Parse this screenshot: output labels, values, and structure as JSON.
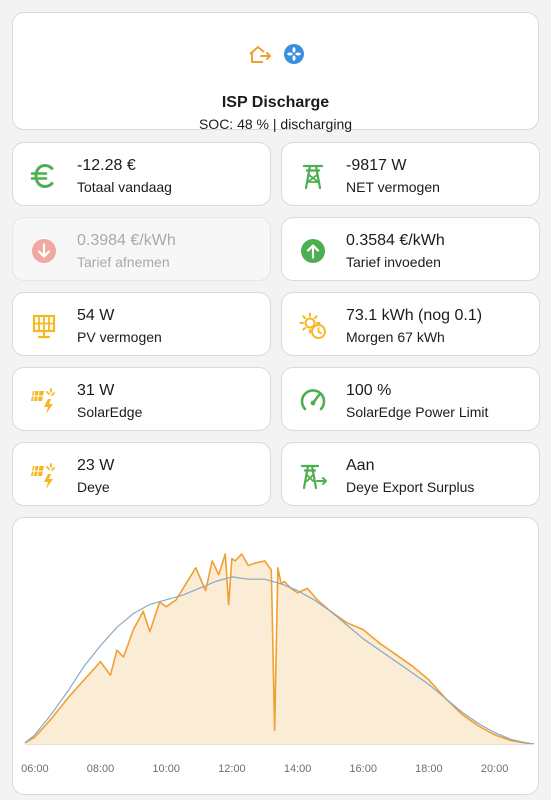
{
  "header": {
    "title": "ISP Discharge",
    "subtitle": "SOC: 48 % | discharging",
    "icons": [
      "home-export-icon",
      "fan-icon"
    ],
    "icon_colors": {
      "home": "#f0a030",
      "fan": "#3b8fe0"
    }
  },
  "tiles": [
    {
      "value": "-12.28 €",
      "label": "Totaal vandaag",
      "icon": "euro-icon",
      "color": "#4caf50"
    },
    {
      "value": "-9817 W",
      "label": "NET vermogen",
      "icon": "transmission-tower-icon",
      "color": "#4caf50"
    },
    {
      "value": "0.3984 €/kWh",
      "label": "Tarief afnemen",
      "icon": "arrow-down-circle-icon",
      "color": "#f0a8a0",
      "state": "disabled"
    },
    {
      "value": "0.3584 €/kWh",
      "label": "Tarief invoeden",
      "icon": "arrow-up-circle-icon",
      "color": "#4caf50"
    },
    {
      "value": "54 W",
      "label": "PV vermogen",
      "icon": "solar-panel-icon",
      "color": "#f5b820"
    },
    {
      "value": "73.1 kWh (nog 0.1)",
      "label": "Morgen 67 kWh",
      "icon": "weather-sunny-clock-icon",
      "color": "#f5b820"
    },
    {
      "value": "31 W",
      "label": "SolarEdge",
      "icon": "solar-power-icon",
      "color": "#f5b820"
    },
    {
      "value": "100 %",
      "label": "SolarEdge Power Limit",
      "icon": "gauge-icon",
      "color": "#4caf50"
    },
    {
      "value": "23 W",
      "label": "Deye",
      "icon": "solar-power-icon",
      "color": "#f5b820"
    },
    {
      "value": "Aan",
      "label": "Deye Export Surplus",
      "icon": "transmission-tower-export-icon",
      "color": "#4caf50"
    }
  ],
  "chart_data": {
    "type": "area",
    "x_ticks": [
      "06:00",
      "08:00",
      "10:00",
      "12:00",
      "14:00",
      "16:00",
      "18:00",
      "20:00"
    ],
    "xlim": [
      5.7,
      21.2
    ],
    "ylim": [
      0,
      9
    ],
    "grid": false,
    "series": [
      {
        "color": "#f0a030",
        "fill": "#fbecd6",
        "x": [
          5.7,
          6.0,
          6.5,
          7.0,
          7.5,
          8.0,
          8.3,
          8.5,
          8.7,
          9.0,
          9.3,
          9.5,
          9.8,
          10.0,
          10.3,
          10.6,
          10.9,
          11.2,
          11.4,
          11.6,
          11.8,
          11.9,
          12.0,
          12.1,
          12.3,
          12.5,
          12.7,
          13.0,
          13.2,
          13.3,
          13.4,
          13.5,
          13.6,
          13.8,
          14.0,
          14.3,
          14.6,
          15.0,
          15.5,
          16.0,
          16.5,
          17.0,
          17.5,
          18.0,
          18.5,
          19.0,
          19.5,
          20.0,
          20.5,
          21.0,
          21.2
        ],
        "y": [
          0.05,
          0.3,
          1.1,
          2.0,
          2.8,
          3.6,
          3.0,
          4.1,
          3.8,
          5.0,
          5.8,
          4.9,
          6.2,
          6.0,
          6.3,
          7.0,
          7.7,
          6.7,
          8.0,
          7.4,
          8.3,
          6.1,
          8.1,
          8.0,
          8.3,
          7.8,
          7.9,
          8.0,
          7.6,
          0.6,
          7.7,
          7.0,
          7.1,
          6.8,
          6.6,
          6.8,
          6.3,
          5.8,
          5.3,
          5.0,
          4.4,
          3.9,
          3.4,
          2.8,
          2.0,
          1.3,
          0.8,
          0.4,
          0.15,
          0.03,
          0.0
        ]
      },
      {
        "color": "#8aa8c8",
        "x": [
          5.7,
          6.0,
          6.5,
          7.0,
          7.5,
          8.0,
          8.5,
          9.0,
          9.5,
          10.0,
          10.5,
          11.0,
          11.5,
          12.0,
          12.5,
          13.0,
          13.5,
          14.0,
          14.5,
          15.0,
          15.5,
          16.0,
          16.5,
          17.0,
          17.5,
          18.0,
          18.5,
          19.0,
          19.5,
          20.0,
          20.5,
          21.0,
          21.2
        ],
        "y": [
          0.05,
          0.4,
          1.3,
          2.3,
          3.4,
          4.3,
          5.1,
          5.7,
          6.1,
          6.3,
          6.5,
          6.8,
          7.1,
          7.3,
          7.2,
          7.2,
          7.0,
          6.7,
          6.3,
          5.8,
          5.2,
          4.6,
          4.1,
          3.6,
          3.1,
          2.6,
          2.0,
          1.4,
          0.9,
          0.5,
          0.2,
          0.04,
          0.0
        ]
      }
    ]
  }
}
